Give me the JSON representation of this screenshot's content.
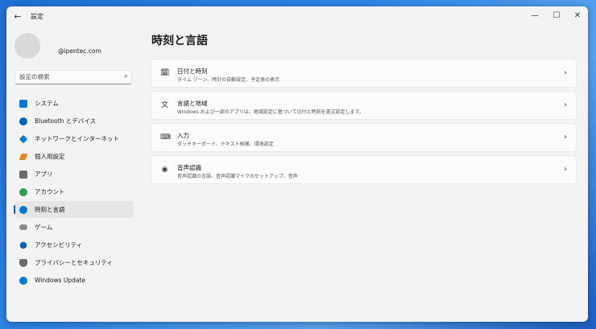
{
  "app": {
    "title": "設定"
  },
  "window": {
    "minimize": "—",
    "maximize": "☐",
    "close": "✕"
  },
  "account": {
    "email": "@ipentec.com"
  },
  "search": {
    "placeholder": "設定の検索"
  },
  "sidebar": {
    "items": [
      {
        "label": "システム",
        "icon": "system-icon",
        "color": "#0078d4"
      },
      {
        "label": "Bluetooth とデバイス",
        "icon": "bluetooth-icon",
        "color": "#0063b1"
      },
      {
        "label": "ネットワークとインターネット",
        "icon": "network-icon",
        "color": "#0078d4"
      },
      {
        "label": "個人用設定",
        "icon": "personalization-icon",
        "color": "#e08a2e"
      },
      {
        "label": "アプリ",
        "icon": "apps-icon",
        "color": "#6b6b6b"
      },
      {
        "label": "アカウント",
        "icon": "accounts-icon",
        "color": "#2e9d4f"
      },
      {
        "label": "時刻と言語",
        "icon": "time-language-icon",
        "color": "#0078d4",
        "active": true
      },
      {
        "label": "ゲーム",
        "icon": "gaming-icon",
        "color": "#8a8a8a"
      },
      {
        "label": "アクセシビリティ",
        "icon": "accessibility-icon",
        "color": "#0063b1"
      },
      {
        "label": "プライバシーとセキュリティ",
        "icon": "privacy-icon",
        "color": "#6b6b6b"
      },
      {
        "label": "Windows Update",
        "icon": "windows-update-icon",
        "color": "#0078d4"
      }
    ]
  },
  "main": {
    "title": "時刻と言語",
    "cards": [
      {
        "title": "日付と時刻",
        "description": "タイム ゾーン、時計の自動設定、予定表の表示",
        "icon": "date-time-icon"
      },
      {
        "title": "言語と地域",
        "description": "Windows および一部のアプリは、地域設定に基づいて日付と時刻を書式設定します。",
        "icon": "language-region-icon"
      },
      {
        "title": "入力",
        "description": "タッチキーボード、テキスト候補、環境設定",
        "icon": "typing-icon"
      },
      {
        "title": "音声認識",
        "description": "音声認識の言語、音声認識マイクのセットアップ、音声",
        "icon": "speech-icon"
      }
    ]
  }
}
